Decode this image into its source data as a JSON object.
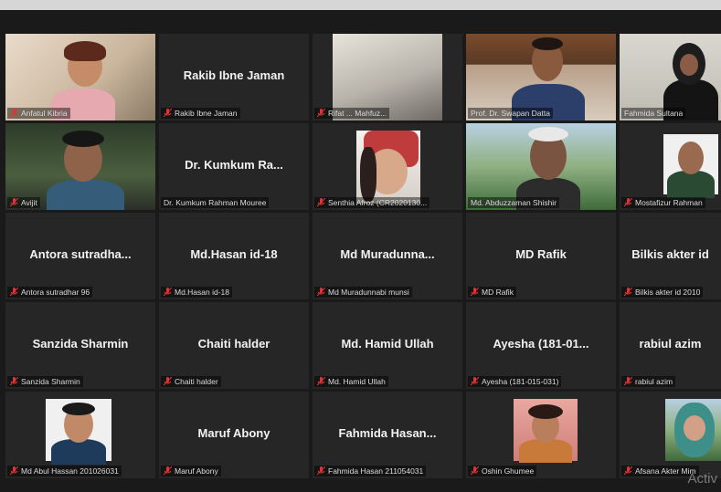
{
  "accent": "#c9e265",
  "mic_muted_color": "#e03434",
  "watermark": "Activ",
  "tiles": [
    {
      "display": "",
      "label": "Anfatul Kibria"
    },
    {
      "display": "Rakib Ibne Jaman",
      "label": "Rakib Ibne Jaman"
    },
    {
      "display": "",
      "label": "Rifat ... Mahfuz..."
    },
    {
      "display": "",
      "label": "Prof. Dr. Swapan Datta"
    },
    {
      "display": "",
      "label": "Fahmida Sultana"
    },
    {
      "display": "",
      "label": "Avijit"
    },
    {
      "display": "Dr. Kumkum Ra...",
      "label": "Dr. Kumkum Rahman Mouree"
    },
    {
      "display": "",
      "label": "Senthia Afroz (CR2020130..."
    },
    {
      "display": "",
      "label": "Md. Abduzzaman Shishir"
    },
    {
      "display": "",
      "label": "Mostafizur Rahman"
    },
    {
      "display": "Antora sutradha...",
      "label": "Antora sutradhar 96"
    },
    {
      "display": "Md.Hasan id-18",
      "label": "Md.Hasan id-18"
    },
    {
      "display": "Md  Muradunna...",
      "label": "Md Muradunnabi munsi"
    },
    {
      "display": "MD Rafik",
      "label": "MD Rafik"
    },
    {
      "display": "Bilkis akter id",
      "label": "Bilkis akter id 2010"
    },
    {
      "display": "Sanzida Sharmin",
      "label": "Sanzida Sharmin"
    },
    {
      "display": "Chaiti halder",
      "label": "Chaiti halder"
    },
    {
      "display": "Md. Hamid Ullah",
      "label": "Md. Hamid Ullah"
    },
    {
      "display": "Ayesha (181-01...",
      "label": "Ayesha (181-015-031)"
    },
    {
      "display": "rabiul azim",
      "label": "rabiul azim"
    },
    {
      "display": "",
      "label": "Md Abul Hassan 201026031"
    },
    {
      "display": "Maruf Abony",
      "label": "Maruf Abony"
    },
    {
      "display": "Fahmida  Hasan...",
      "label": "Fahmida Hasan 211054031"
    },
    {
      "display": "",
      "label": "Oshin Ghumee"
    },
    {
      "display": "",
      "label": "Afsana Akter Mim"
    }
  ]
}
